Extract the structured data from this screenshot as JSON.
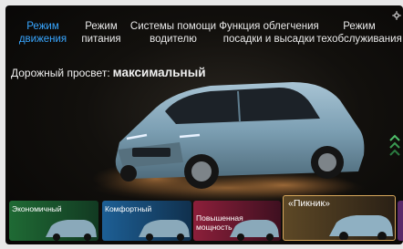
{
  "tabs": [
    {
      "lines": [
        "Режим",
        "движения"
      ],
      "active": true
    },
    {
      "lines": [
        "Режим",
        "питания"
      ],
      "active": false
    },
    {
      "lines": [
        "Системы помощи",
        "водителю"
      ],
      "active": false
    },
    {
      "lines": [
        "Функция облегчения",
        "посадки и высадки"
      ],
      "active": false
    },
    {
      "lines": [
        "Режим",
        "техобслуживания"
      ],
      "active": false
    }
  ],
  "clearance": {
    "label": "Дорожный просвет:",
    "value": "максимальный"
  },
  "modes": [
    {
      "label": "Экономичный",
      "selected": false
    },
    {
      "label": "Комфортный",
      "selected": false
    },
    {
      "label": "Повышенная мощность",
      "label_lines": [
        "Повышенная",
        "мощность"
      ],
      "selected": false
    },
    {
      "label": "«Пикник»",
      "selected": true
    }
  ],
  "colors": {
    "active_tab": "#38a6ff",
    "selected_border": "#d8a85c",
    "eco": "#2f9a48",
    "comfort": "#2a7fc2",
    "power": "#b02a4a",
    "picnic": "#6a5330"
  },
  "icons": {
    "settings": "gear-icon",
    "scroll": "chevron-up-icon"
  }
}
